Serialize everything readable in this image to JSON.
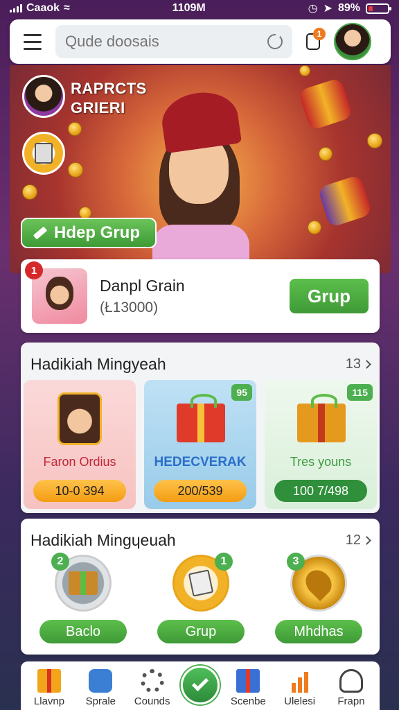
{
  "status_bar": {
    "carrier": "Caaok",
    "time": "1109M",
    "battery": "89%"
  },
  "search": {
    "placeholder": "Qude doosais"
  },
  "notifications": {
    "badge": "1"
  },
  "hero": {
    "title_line1": "RAPRCTS",
    "title_line2": "GRIERI",
    "cta_label": "Hdep Grup"
  },
  "deal": {
    "badge": "1",
    "title": "Danpl Grain",
    "price": "(Ł13000)",
    "button_label": "Grup"
  },
  "section1": {
    "title": "Hadikiah Mingyeah",
    "count": "13",
    "cards": [
      {
        "label": "Faron Ordius",
        "value": "10-0 394",
        "tag": ""
      },
      {
        "label": "HEDECVERAK",
        "value": "200/539",
        "tag": "95"
      },
      {
        "label": "Tres youns",
        "value": "100 7/498",
        "tag": "115"
      }
    ]
  },
  "section2": {
    "title": "Hadikiah Mingɥeuah",
    "count": "12",
    "items": [
      {
        "num": "2",
        "label": "Baclo"
      },
      {
        "num": "1",
        "label": "Grup"
      },
      {
        "num": "3",
        "label": "Mhdhas"
      }
    ]
  },
  "bottom_nav": [
    {
      "label": "Llavnp"
    },
    {
      "label": "Sprale"
    },
    {
      "label": "Counds"
    },
    {
      "label": "Scenbe"
    },
    {
      "label": "Ulelesi"
    },
    {
      "label": "Frapn"
    }
  ],
  "colors": {
    "accent_green": "#4caf50",
    "banner_red": "#a7342e",
    "badge_orange": "#f07a1e"
  }
}
